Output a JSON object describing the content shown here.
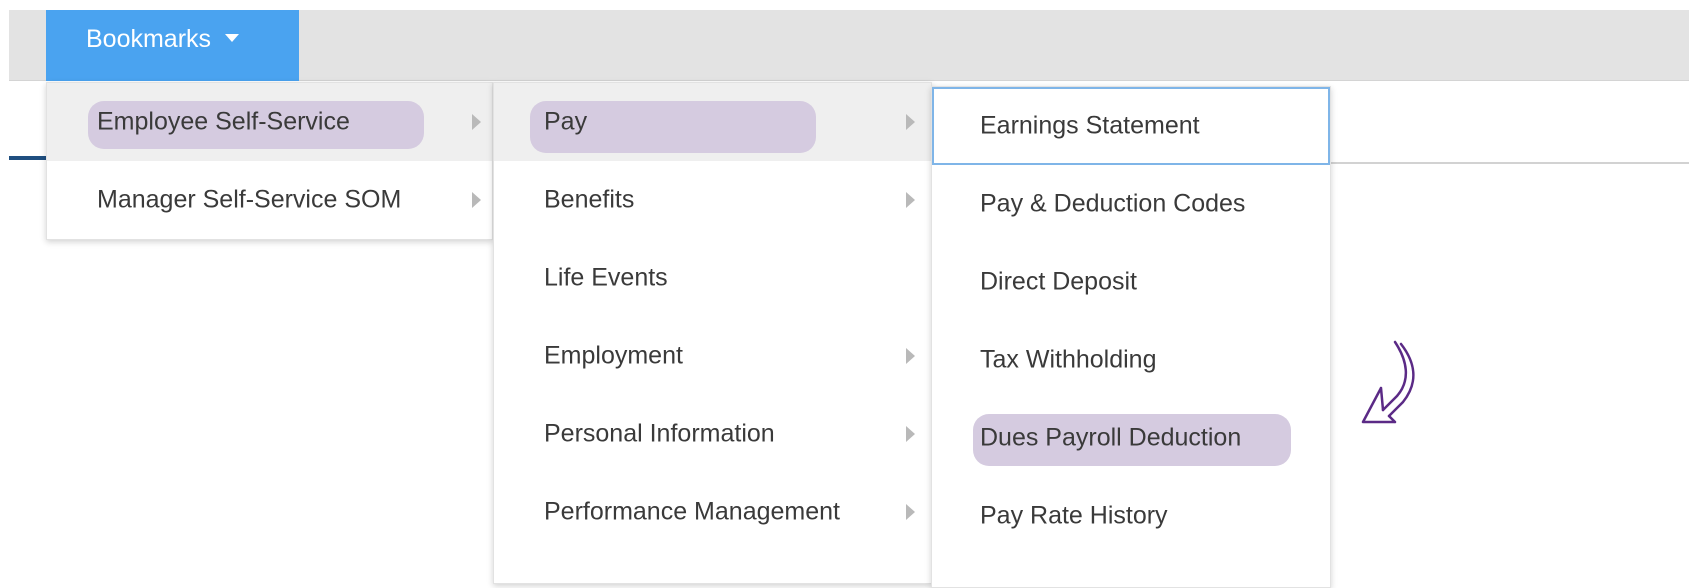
{
  "toolbar": {
    "bookmarks_label": "Bookmarks",
    "caret_icon": "caret-down-icon"
  },
  "menu_level1": {
    "items": [
      {
        "label": "Employee Self-Service",
        "has_submenu": true,
        "highlighted": true
      },
      {
        "label": "Manager Self-Service SOM",
        "has_submenu": true,
        "highlighted": false
      }
    ]
  },
  "menu_level2": {
    "items": [
      {
        "label": "Pay",
        "has_submenu": true,
        "highlighted": true
      },
      {
        "label": "Benefits",
        "has_submenu": true
      },
      {
        "label": "Life Events",
        "has_submenu": false
      },
      {
        "label": "Employment",
        "has_submenu": true
      },
      {
        "label": "Personal Information",
        "has_submenu": true
      },
      {
        "label": "Performance Management",
        "has_submenu": true
      }
    ]
  },
  "menu_level3": {
    "items": [
      {
        "label": "Earnings Statement",
        "focused": true
      },
      {
        "label": "Pay & Deduction Codes"
      },
      {
        "label": "Direct Deposit"
      },
      {
        "label": "Tax Withholding"
      },
      {
        "label": "Dues Payroll Deduction",
        "highlighted": true
      },
      {
        "label": "Pay Rate History"
      }
    ]
  },
  "annotation": {
    "icon": "curved-arrow-icon",
    "color": "#5b2a86"
  },
  "colors": {
    "accent": "#4aa3f0",
    "highlight": "#d5cbe0",
    "focus": "#7fb5e8"
  }
}
